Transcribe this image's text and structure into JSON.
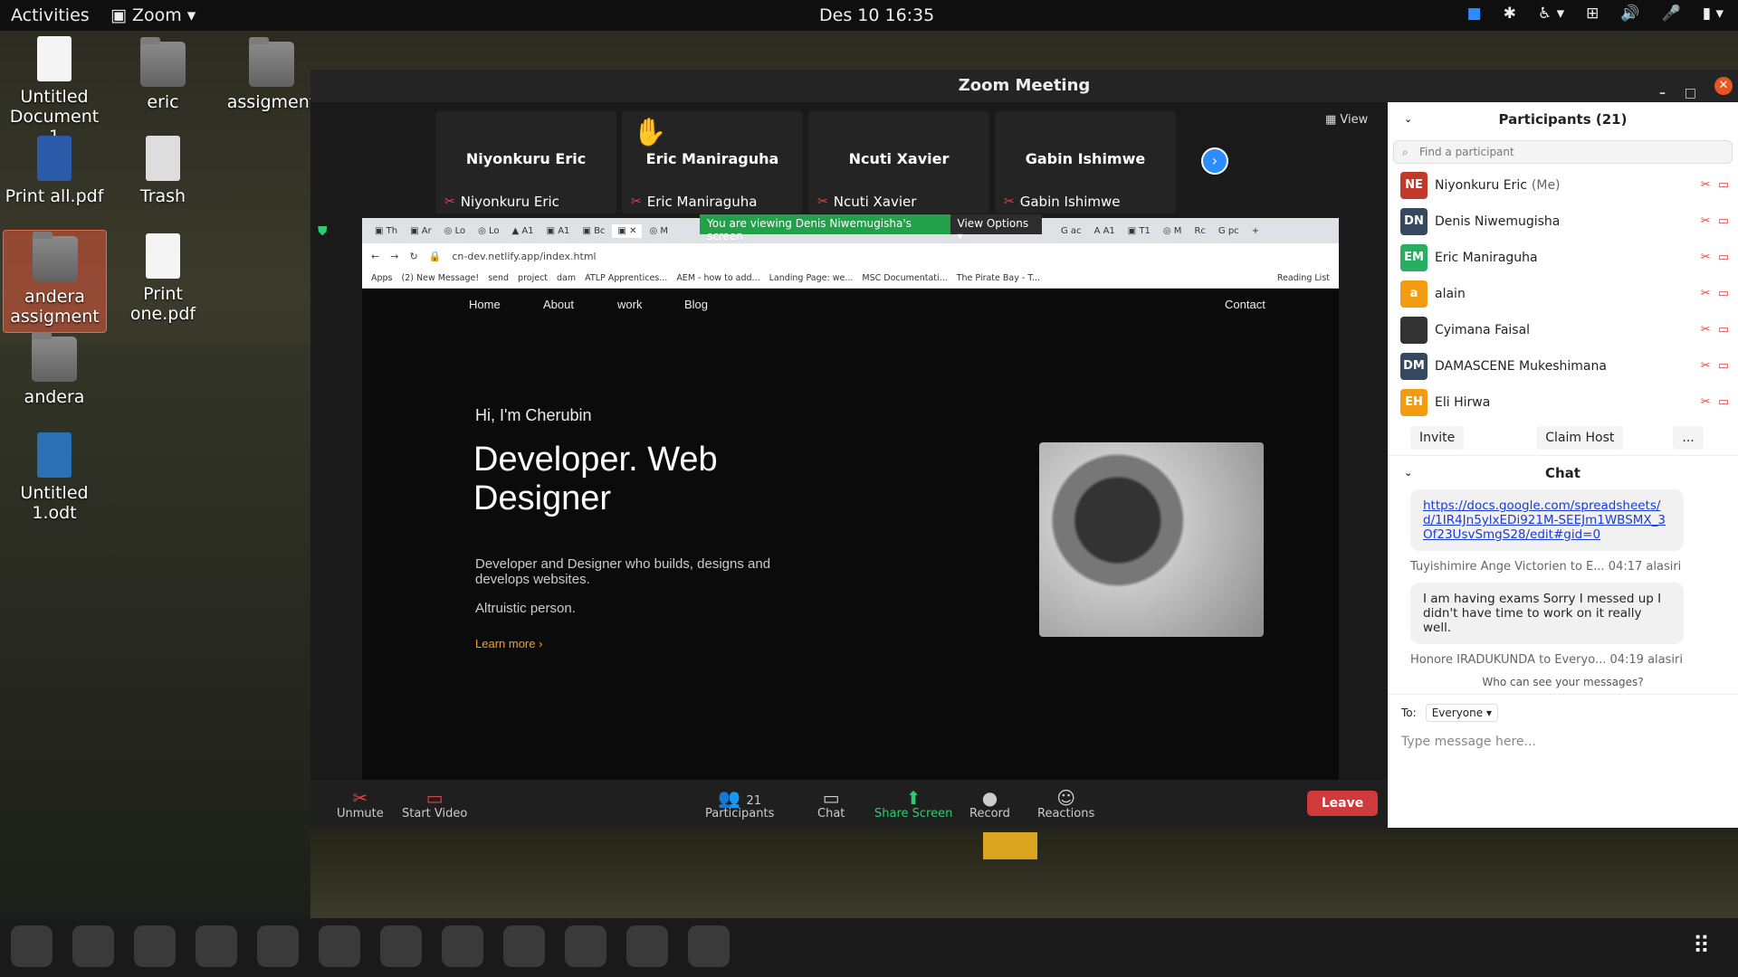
{
  "topbar": {
    "activities": "Activities",
    "app": "Zoom",
    "clock": "Des 10  16:35"
  },
  "desktop": {
    "icons": [
      "Untitled Document 1",
      "eric",
      "assigment",
      "Print all.pdf",
      "Trash",
      "andera assigment",
      "Print one.pdf",
      "andera",
      "Untitled 1.odt"
    ]
  },
  "zoom": {
    "title": "Zoom Meeting",
    "view": "View",
    "tiles": [
      {
        "name": "Niyonkuru Eric",
        "sub": "Niyonkuru Eric"
      },
      {
        "name": "Eric Maniraguha",
        "sub": "Eric Maniraguha"
      },
      {
        "name": "Ncuti Xavier",
        "sub": "Ncuti Xavier"
      },
      {
        "name": "Gabin Ishimwe",
        "sub": "Gabin Ishimwe"
      }
    ],
    "banner": {
      "viewing": "You are viewing Denis Niwemugisha's screen",
      "options": "View Options"
    },
    "browser": {
      "url": "cn-dev.netlify.app/index.html",
      "bookmarks": [
        "Apps",
        "(2) New Message!",
        "send",
        "project",
        "dam",
        "ATLP Apprentices...",
        "AEM - how to add...",
        "Landing Page: we...",
        "MSC Documentati...",
        "The Pirate Bay - T..."
      ],
      "reading": "Reading List"
    },
    "site": {
      "nav": [
        "Home",
        "About",
        "work",
        "Blog"
      ],
      "contact": "Contact",
      "greeting": "Hi, I'm Cherubin",
      "headline1": "Developer. Web",
      "headline2": "Designer",
      "desc1": "Developer and Designer who builds, designs and",
      "desc2": "develops websites.",
      "alt": "Altruistic person.",
      "learn": "Learn more"
    },
    "controls": {
      "unmute": "Unmute",
      "video": "Start Video",
      "participants": "Participants",
      "count": "21",
      "chat": "Chat",
      "share": "Share Screen",
      "record": "Record",
      "reactions": "Reactions",
      "leave": "Leave"
    }
  },
  "panel": {
    "title": "Participants (21)",
    "search": "Find a participant",
    "people": [
      {
        "init": "NE",
        "name": "Niyonkuru Eric",
        "me": "(Me)",
        "color": "#c0392b"
      },
      {
        "init": "DN",
        "name": "Denis Niwemugisha",
        "me": "",
        "color": "#34495e"
      },
      {
        "init": "EM",
        "name": "Eric Maniraguha",
        "me": "",
        "color": "#27ae60"
      },
      {
        "init": "a",
        "name": "alain",
        "me": "",
        "color": "#f39c12"
      },
      {
        "init": "",
        "name": "Cyimana Faisal",
        "me": "",
        "color": "#333333"
      },
      {
        "init": "DM",
        "name": "DAMASCENE Mukeshimana",
        "me": "",
        "color": "#34495e"
      },
      {
        "init": "EH",
        "name": "Eli Hirwa",
        "me": "",
        "color": "#f39c12"
      }
    ],
    "invite": "Invite",
    "claim": "Claim Host",
    "more": "...",
    "chat_title": "Chat",
    "link": "https://docs.google.com/spreadsheets/d/1IR4Jn5ylxEDi921M-SEEJm1WBSMX_3Of23UsvSmgS28/edit#gid=0",
    "msg1_meta": "Tuyishimire Ange Victorien to E...",
    "msg1_time": "04:17 alasiri",
    "msg1": "I am having exams Sorry I messed up I didn't have time to work on it really well.",
    "msg2_meta": "Honore IRADUKUNDA to Everyo...",
    "msg2_time": "04:19 alasiri",
    "who": "Who can see your messages?",
    "to": "To:",
    "everyone": "Everyone",
    "placeholder": "Type message here..."
  }
}
